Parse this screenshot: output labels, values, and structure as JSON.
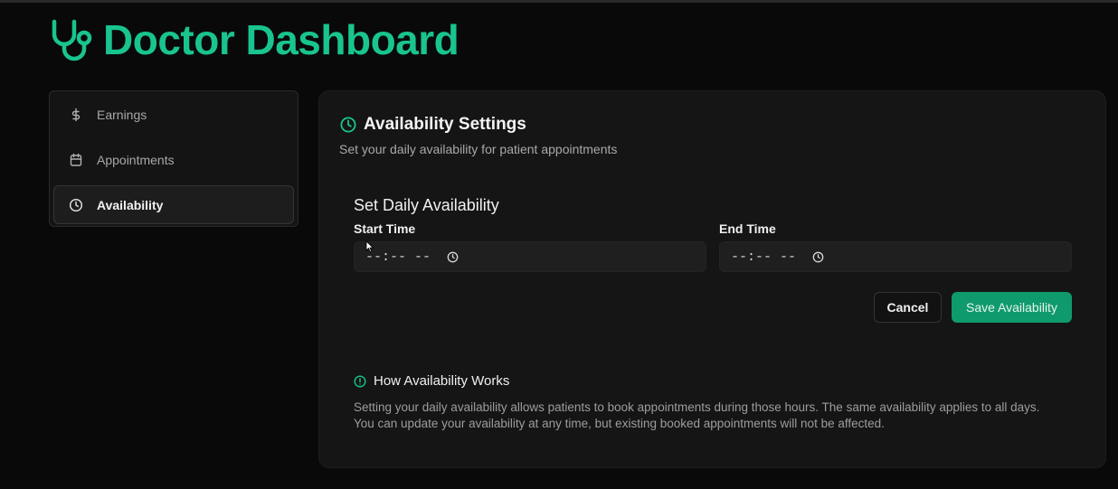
{
  "app": {
    "title": "Doctor Dashboard",
    "logo_icon": "stethoscope-icon",
    "brand_color": "#19c48e"
  },
  "sidebar": {
    "items": [
      {
        "label": "Earnings",
        "icon": "dollar-icon",
        "active": false
      },
      {
        "label": "Appointments",
        "icon": "calendar-icon",
        "active": false
      },
      {
        "label": "Availability",
        "icon": "clock-icon",
        "active": true
      }
    ]
  },
  "main": {
    "title": "Availability Settings",
    "subtitle": "Set your daily availability for patient appointments",
    "section_title": "Set Daily Availability",
    "start_time": {
      "label": "Start Time",
      "value": "--:-- --"
    },
    "end_time": {
      "label": "End Time",
      "value": "--:-- --"
    },
    "cancel_label": "Cancel",
    "save_label": "Save Availability",
    "save_color": "#0f9a6d"
  },
  "info": {
    "title": "How Availability Works",
    "text_line1": "Setting your daily availability allows patients to book appointments during those hours. The same availability applies to all days.",
    "text_line2": "You can update your availability at any time, but existing booked appointments will not be affected."
  }
}
